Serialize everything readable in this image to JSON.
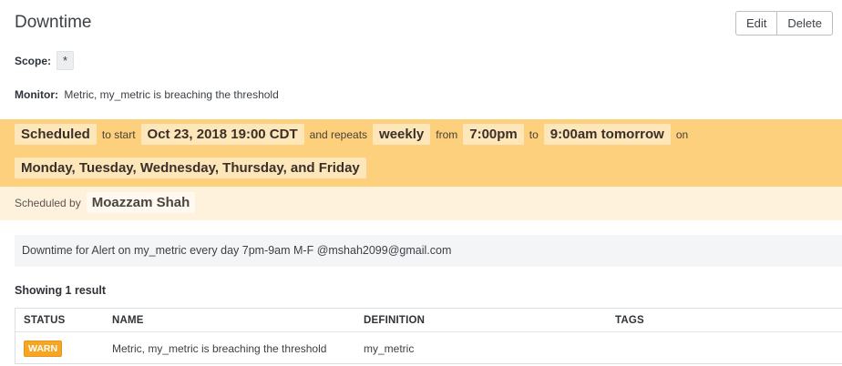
{
  "page": {
    "title": "Downtime"
  },
  "actions": {
    "edit_label": "Edit",
    "delete_label": "Delete"
  },
  "scope": {
    "label": "Scope:",
    "value": "*"
  },
  "monitor": {
    "label": "Monitor:",
    "value": "Metric, my_metric is breaching the threshold"
  },
  "schedule": {
    "status": "Scheduled",
    "to_start": "to start",
    "start": "Oct 23, 2018 19:00 CDT",
    "and_repeats": "and repeats",
    "frequency": "weekly",
    "from": "from",
    "from_time": "7:00pm",
    "to": "to",
    "to_time": "9:00am tomorrow",
    "on": "on",
    "days": "Monday, Tuesday, Wednesday, Thursday, and Friday"
  },
  "scheduled_by": {
    "label": "Scheduled by",
    "name": "Moazzam Shah"
  },
  "message": "Downtime for Alert on my_metric every day 7pm-9am M-F @mshah2099@gmail.com",
  "results": {
    "summary": "Showing 1 result",
    "columns": [
      "STATUS",
      "NAME",
      "DEFINITION",
      "TAGS"
    ],
    "rows": [
      {
        "status": "WARN",
        "name": "Metric, my_metric is breaching the threshold",
        "definition": "my_metric",
        "tags": ""
      }
    ]
  },
  "colors": {
    "schedule_band": "#fdd07d",
    "scheduled_by_band": "#fff2dc",
    "warn_badge": "#f5a623"
  }
}
